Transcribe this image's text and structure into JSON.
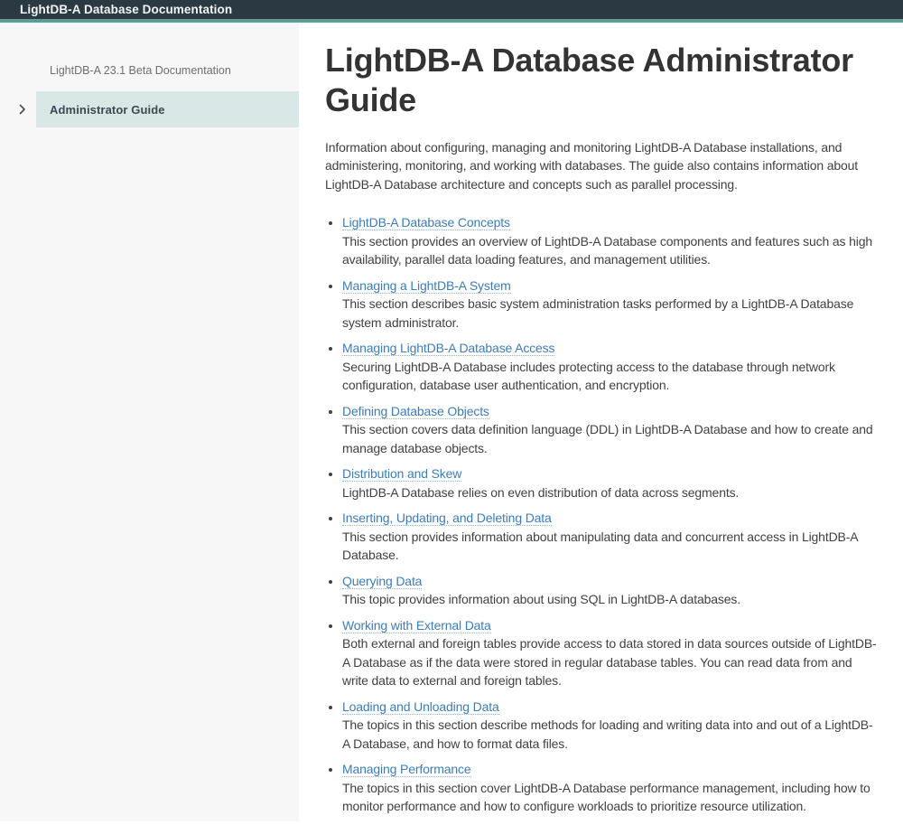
{
  "header": {
    "title": "LightDB-A Database Documentation"
  },
  "sidebar": {
    "docset_label": "LightDB-A 23.1 Beta Documentation",
    "active_item": {
      "label": "Administrator Guide",
      "expanded": false
    }
  },
  "main": {
    "title": "LightDB-A Database Administrator Guide",
    "intro": "Information about configuring, managing and monitoring LightDB-A Database installations, and administering, monitoring, and working with databases. The guide also contains information about LightDB-A Database architecture and concepts such as parallel processing.",
    "toc": [
      {
        "label": "LightDB-A Database Concepts",
        "description": "This section provides an overview of LightDB-A Database components and features such as high availability, parallel data loading features, and management utilities."
      },
      {
        "label": "Managing a LightDB-A System",
        "description": "This section describes basic system administration tasks performed by a LightDB-A Database system administrator."
      },
      {
        "label": "Managing LightDB-A Database Access",
        "description": "Securing LightDB-A Database includes protecting access to the database through network configuration, database user authentication, and encryption."
      },
      {
        "label": "Defining Database Objects",
        "description": "This section covers data definition language (DDL) in LightDB-A Database and how to create and manage database objects."
      },
      {
        "label": "Distribution and Skew",
        "description": "LightDB-A Database relies on even distribution of data across segments."
      },
      {
        "label": "Inserting, Updating, and Deleting Data",
        "description": "This section provides information about manipulating data and concurrent access in LightDB-A Database."
      },
      {
        "label": "Querying Data",
        "description": "This topic provides information about using SQL in LightDB-A databases."
      },
      {
        "label": "Working with External Data",
        "description": "Both external and foreign tables provide access to data stored in data sources outside of LightDB-A Database as if the data were stored in regular database tables. You can read data from and write data to external and foreign tables."
      },
      {
        "label": "Loading and Unloading Data",
        "description": "The topics in this section describe methods for loading and writing data into and out of a LightDB-A Database, and how to format data files."
      },
      {
        "label": "Managing Performance",
        "description": "The topics in this section cover LightDB-A Database performance management, including how to monitor performance and how to configure workloads to prioritize resource utilization."
      }
    ]
  },
  "colors": {
    "header_bg": "#2b3942",
    "accent_teal": "#5b9e98",
    "sidebar_bg": "#f7f7f7",
    "active_item_bg": "#d9e8e6",
    "link_blue": "#3e7cb6",
    "body_text": "#414141"
  }
}
